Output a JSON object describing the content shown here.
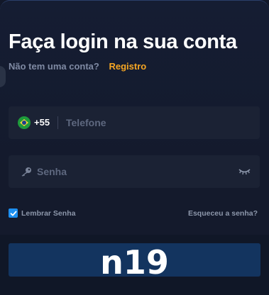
{
  "login": {
    "title": "Faça login na sua conta",
    "no_account_text": "Não tem uma conta?",
    "register_link": "Registro"
  },
  "phone": {
    "country_code": "+55",
    "placeholder": "Telefone",
    "flag": "brazil-flag-icon"
  },
  "password": {
    "placeholder": "Senha",
    "icons": [
      "key-icon",
      "eye-closed-icon"
    ]
  },
  "remember": {
    "label": "Lembrar Senha",
    "checked": true
  },
  "forgot_link": "Esqueceu a senha?",
  "watermark": "n19",
  "colors": {
    "accent": "#f6a623",
    "checkbox": "#1d8ff0",
    "button": "#13345f",
    "background": "#141a2c"
  }
}
